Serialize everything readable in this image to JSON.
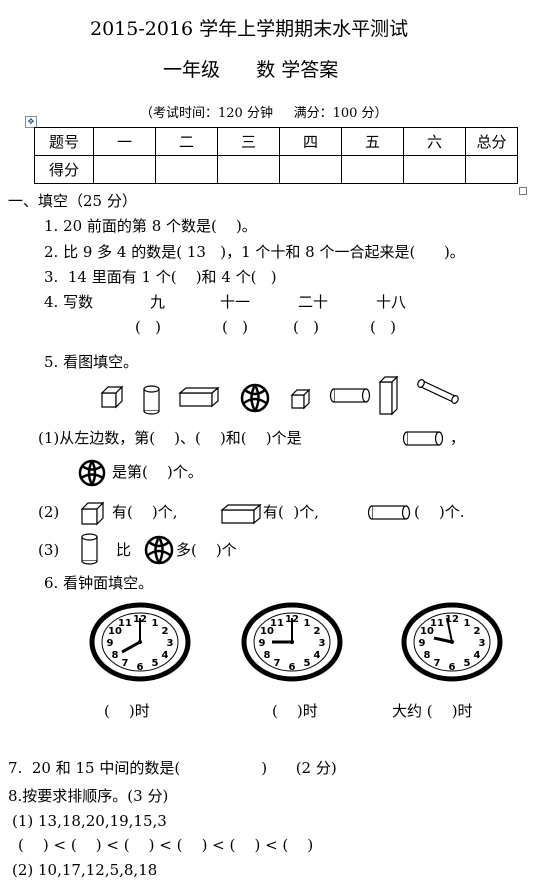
{
  "header": {
    "title": "2015-2016 学年上学期期末水平测试",
    "subtitle": "一年级      数 学答案",
    "exam_info": "（考试时间：120 分钟     满分：100 分）"
  },
  "score_table": {
    "row1": [
      "题号",
      "一",
      "二",
      "三",
      "四",
      "五",
      "六",
      "总分"
    ],
    "row2_label": "得分"
  },
  "section1": {
    "heading": "一、填空（25 分）",
    "q1": "1. 20 前面的第 8 个数是(    )。",
    "q2": "2. 比 9 多 4 的数是( 13   )，1 个十和 8 个一合起来是(      )。",
    "q3": "3.  14 里面有 1 个(    )和 4 个(   )",
    "q4": {
      "label": "4. 写数",
      "words": [
        "九",
        "十一",
        "二十",
        "十八"
      ],
      "blank": "(   )"
    },
    "q5": {
      "label": "5. 看图填空。",
      "line1_prefix": "(1)从左边数，第(    )、(    )和(    )个是",
      "line1_suffix": "，",
      "line2_suffix": "是第(    )个。",
      "row2_label": "(2)",
      "row2_a": "有(    )个,",
      "row2_b": "有(  )个,",
      "row2_c": "(    )个.",
      "row3_label": "(3)",
      "row3_mid": "比",
      "row3_end": "多(    )个"
    },
    "q6": {
      "label": "6. 看钟面填空。",
      "answers": [
        "(    )时",
        "(    )时",
        "大约 (    )时"
      ]
    },
    "q7": "7.  20 和 15 中间的数是(                 )      (2 分)",
    "q8": {
      "label": "8.按要求排顺序。(3 分)",
      "part1": "(1) 13,18,20,19,15,3",
      "part1_blanks": "(    ) < (    ) < (    ) < (    ) < (    ) < (    )",
      "part2": "(2) 10,17,12,5,8,18"
    }
  },
  "icons": {
    "shapes_row": [
      "cube-icon",
      "cylinder-icon",
      "cuboid-icon",
      "ball-icon",
      "cube-icon",
      "cylinder-lying-icon",
      "cuboid-standing-icon",
      "cylinder-tilted-icon"
    ],
    "clocks": [
      "clock-8-icon",
      "clock-9-icon",
      "clock-about-9-icon"
    ]
  }
}
